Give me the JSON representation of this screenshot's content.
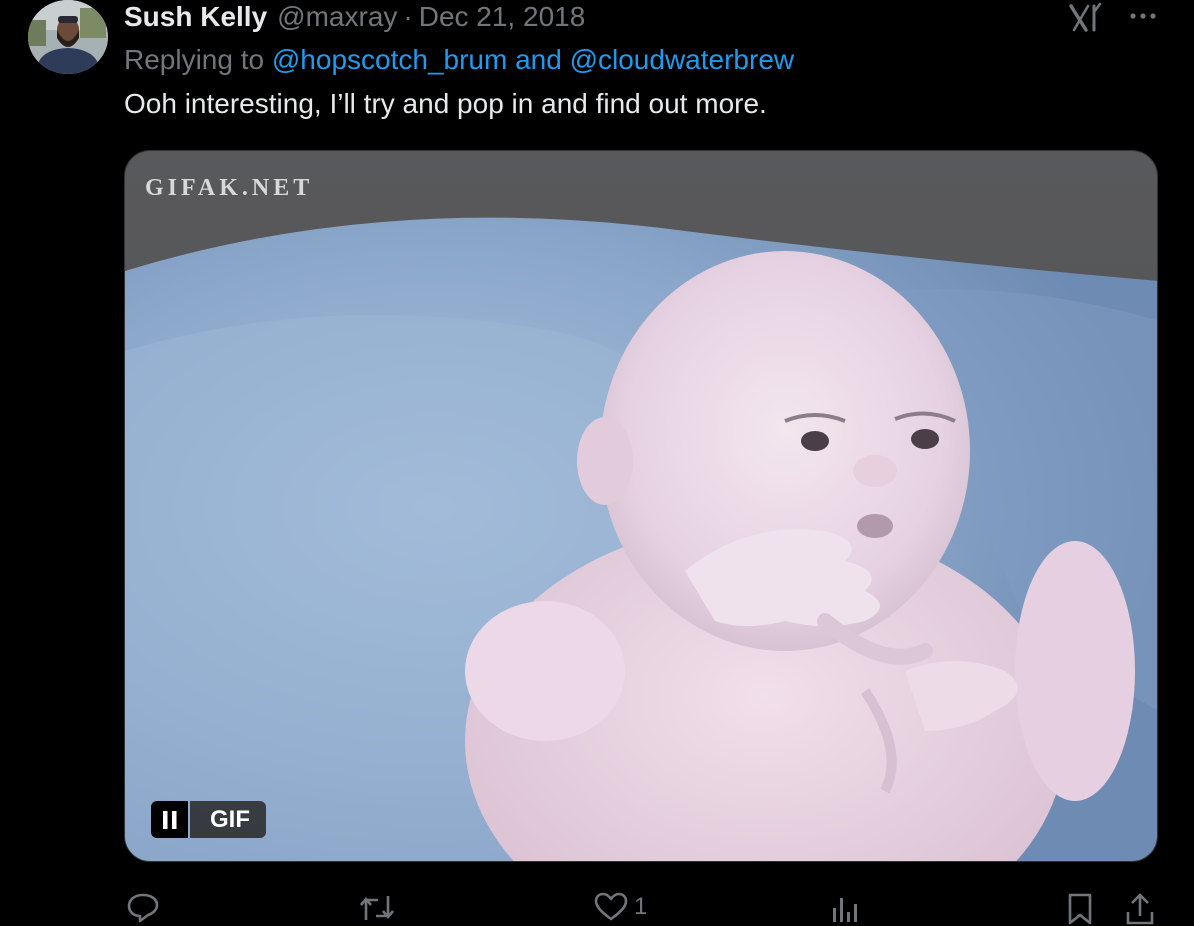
{
  "tweet": {
    "display_name": "Sush Kelly",
    "handle": "@maxray",
    "separator": "·",
    "date": "Dec 21, 2018",
    "replying_prefix": "Replying to",
    "reply_to_1": "@hopscotch_brum",
    "reply_joiner": "and",
    "reply_to_2": "@cloudwaterbrew",
    "text": "Ooh interesting, I’ll try and pop in and find out more.",
    "more_label": "···"
  },
  "media": {
    "watermark": "GIFAK.NET",
    "badge_label": "GIF",
    "pause_icon": "pause-icon"
  },
  "actions": {
    "reply": {
      "icon": "reply-icon",
      "count": ""
    },
    "retweet": {
      "icon": "retweet-icon",
      "count": ""
    },
    "like": {
      "icon": "heart-icon",
      "count": "1"
    },
    "views": {
      "icon": "views-icon",
      "count": ""
    },
    "bookmark": {
      "icon": "bookmark-icon"
    },
    "share": {
      "icon": "share-icon"
    }
  },
  "colors": {
    "background": "#000000",
    "text_primary": "#e7e9ea",
    "text_secondary": "#71767b",
    "link": "#1d9bf0"
  }
}
